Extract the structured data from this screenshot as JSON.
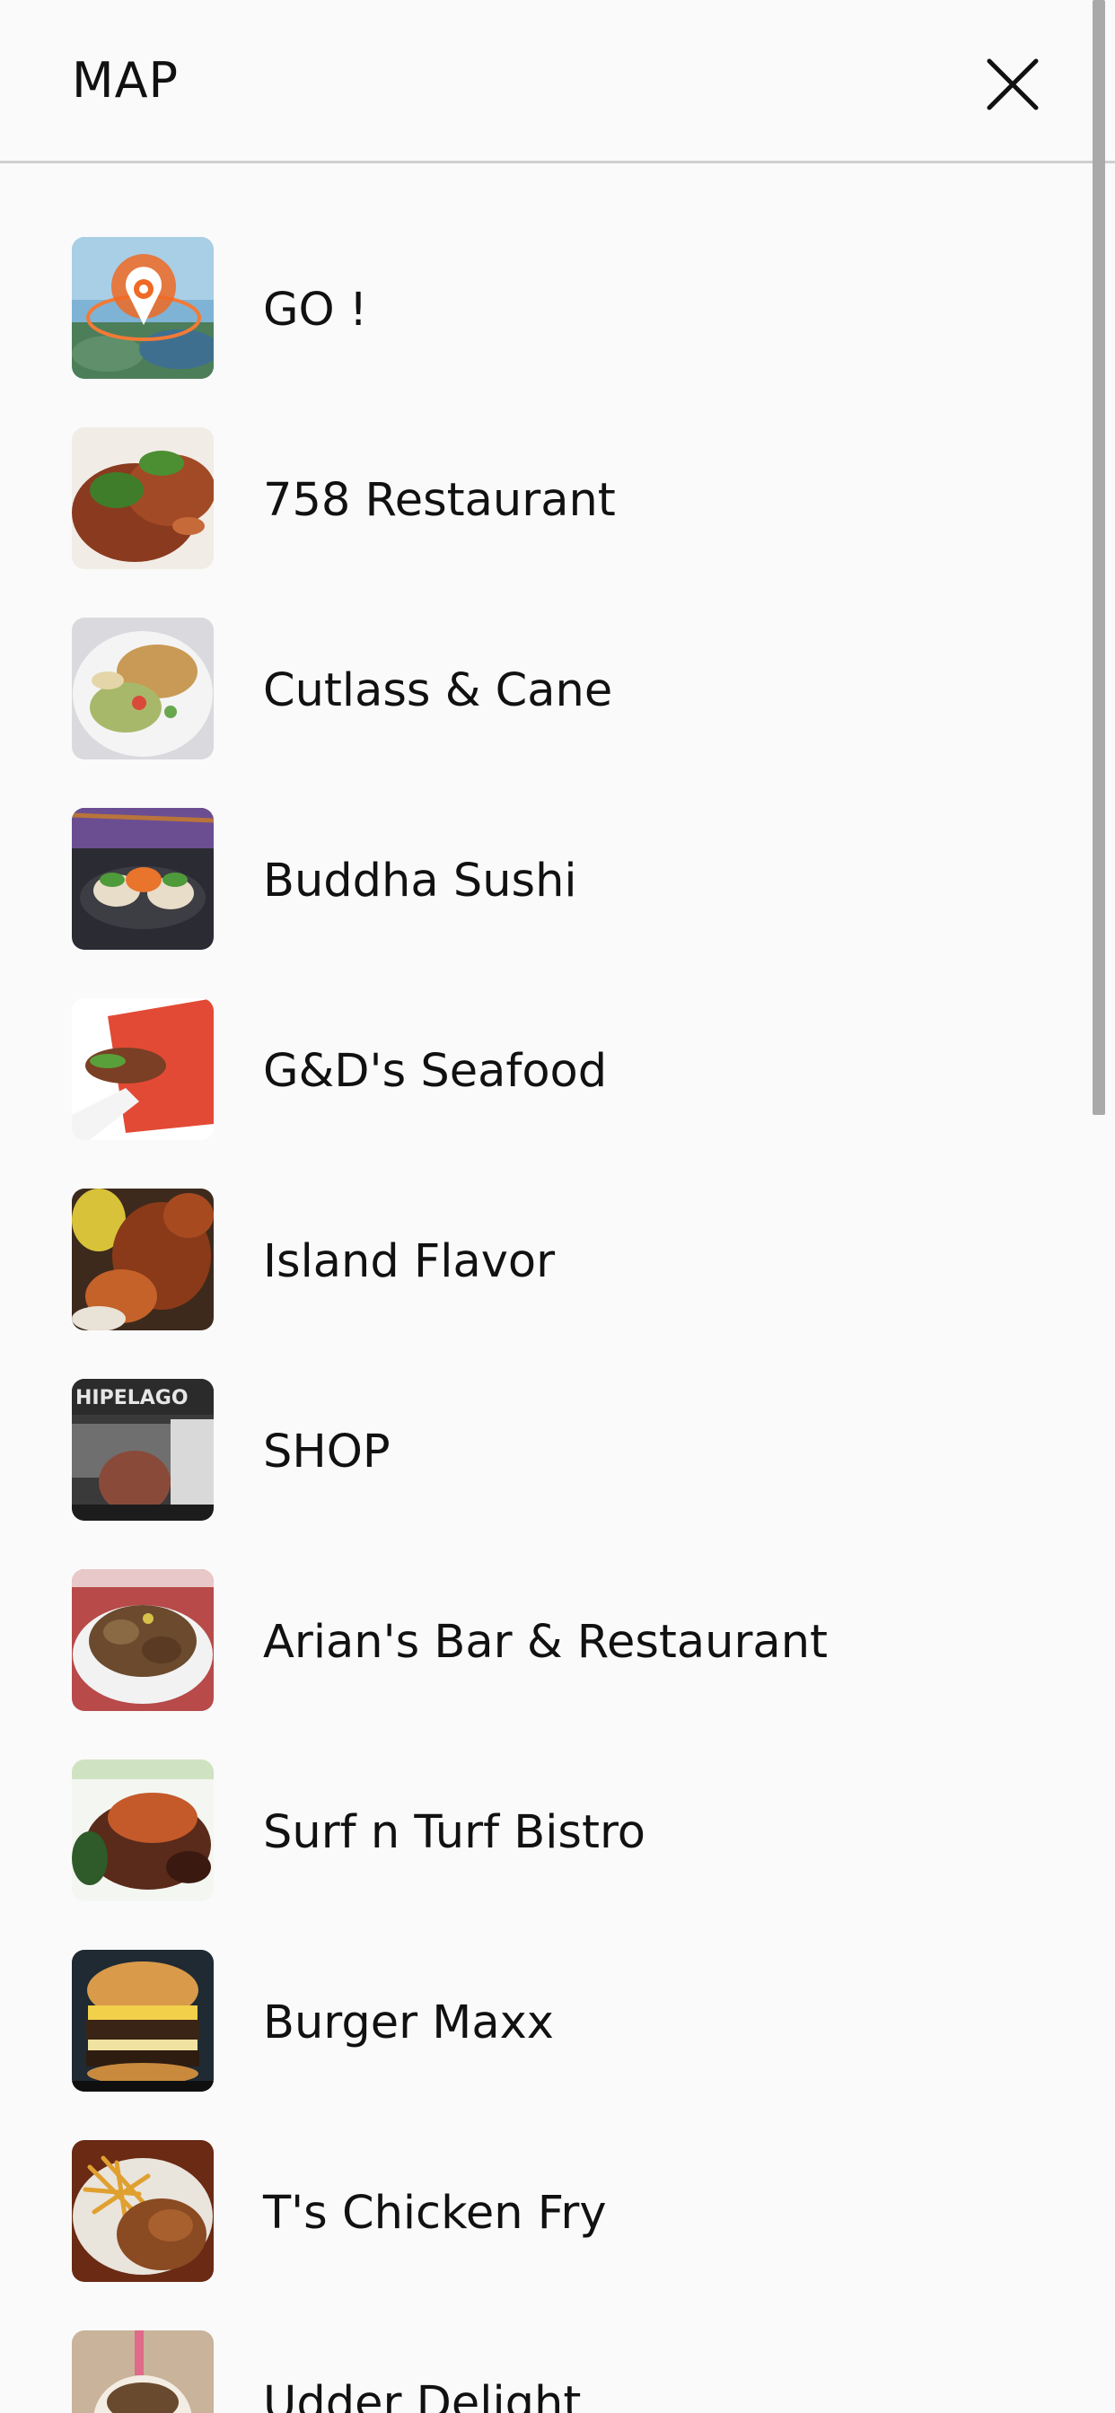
{
  "header": {
    "title": "MAP",
    "close_icon": "close-icon"
  },
  "items": [
    {
      "label": "GO !",
      "thumb": "map-pin-thumbnail"
    },
    {
      "label": "758 Restaurant",
      "thumb": "food-photo"
    },
    {
      "label": "Cutlass & Cane",
      "thumb": "food-photo"
    },
    {
      "label": "Buddha Sushi",
      "thumb": "food-photo"
    },
    {
      "label": "G&D's Seafood",
      "thumb": "food-photo"
    },
    {
      "label": "Island Flavor",
      "thumb": "food-photo"
    },
    {
      "label": "SHOP",
      "thumb": "shop-photo"
    },
    {
      "label": "Arian's Bar & Restaurant",
      "thumb": "food-photo"
    },
    {
      "label": "Surf n Turf Bistro",
      "thumb": "food-photo"
    },
    {
      "label": "Burger Maxx",
      "thumb": "food-photo"
    },
    {
      "label": "T's Chicken Fry",
      "thumb": "food-photo"
    },
    {
      "label": "Udder Delight",
      "thumb": "food-photo"
    }
  ],
  "colors": {
    "accent": "#ef6a25",
    "divider": "#cfcfcf",
    "scrollbar": "#a9a9a9"
  }
}
